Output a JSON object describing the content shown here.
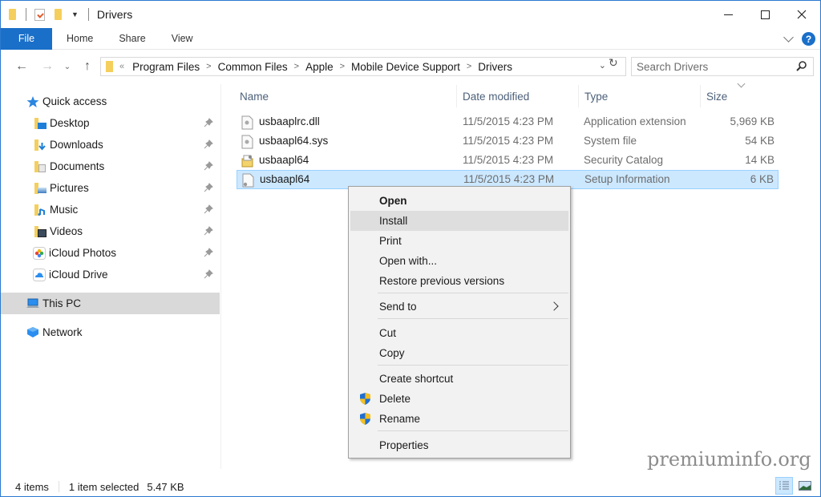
{
  "window": {
    "title": "Drivers",
    "controls": {
      "minimize": "minimize",
      "maximize": "maximize",
      "close": "close"
    }
  },
  "quick_access_toolbar": {
    "icons": [
      "folder-icon",
      "properties-icon",
      "new-folder-icon",
      "customize-dropdown-icon"
    ]
  },
  "ribbon": {
    "tabs": [
      {
        "label": "File",
        "active": true
      },
      {
        "label": "Home"
      },
      {
        "label": "Share"
      },
      {
        "label": "View"
      }
    ],
    "help_label": "?"
  },
  "navigation": {
    "back": "←",
    "forward": "→",
    "recent": "⌄",
    "up": "↑",
    "breadcrumb_overflow": "«",
    "breadcrumb": [
      "Program Files",
      "Common Files",
      "Apple",
      "Mobile Device Support",
      "Drivers"
    ],
    "refresh": "↻",
    "search": {
      "placeholder": "Search Drivers",
      "value": ""
    }
  },
  "sidebar": {
    "quick_access": {
      "label": "Quick access"
    },
    "items": [
      {
        "label": "Desktop",
        "pinned": true,
        "icon": "desktop-folder-icon"
      },
      {
        "label": "Downloads",
        "pinned": true,
        "icon": "downloads-folder-icon"
      },
      {
        "label": "Documents",
        "pinned": true,
        "icon": "documents-folder-icon"
      },
      {
        "label": "Pictures",
        "pinned": true,
        "icon": "pictures-folder-icon"
      },
      {
        "label": "Music",
        "pinned": true,
        "icon": "music-folder-icon"
      },
      {
        "label": "Videos",
        "pinned": true,
        "icon": "videos-folder-icon"
      },
      {
        "label": "iCloud Photos",
        "pinned": true,
        "icon": "icloud-photos-icon"
      },
      {
        "label": "iCloud Drive",
        "pinned": true,
        "icon": "icloud-drive-icon"
      }
    ],
    "this_pc": {
      "label": "This PC",
      "selected": true
    },
    "network": {
      "label": "Network"
    }
  },
  "file_list": {
    "columns": [
      "Name",
      "Date modified",
      "Type",
      "Size"
    ],
    "sorted_by": "Size",
    "rows": [
      {
        "name": "usbaaplrc.dll",
        "date": "11/5/2015 4:23 PM",
        "type": "Application extension",
        "size": "5,969 KB",
        "icon": "dll-file-icon",
        "selected": false
      },
      {
        "name": "usbaapl64.sys",
        "date": "11/5/2015 4:23 PM",
        "type": "System file",
        "size": "54 KB",
        "icon": "sys-file-icon",
        "selected": false
      },
      {
        "name": "usbaapl64",
        "date": "11/5/2015 4:23 PM",
        "type": "Security Catalog",
        "size": "14 KB",
        "icon": "security-catalog-icon",
        "selected": false
      },
      {
        "name": "usbaapl64",
        "date": "11/5/2015 4:23 PM",
        "type": "Setup Information",
        "size": "6 KB",
        "icon": "setup-info-icon",
        "selected": true
      }
    ]
  },
  "context_menu": {
    "items": [
      {
        "label": "Open",
        "bold": true
      },
      {
        "label": "Install",
        "hover": true
      },
      {
        "label": "Print"
      },
      {
        "label": "Open with..."
      },
      {
        "label": "Restore previous versions"
      },
      {
        "label": "Send to",
        "submenu": true
      },
      {
        "label": "Cut"
      },
      {
        "label": "Copy"
      },
      {
        "label": "Create shortcut"
      },
      {
        "label": "Delete",
        "shield": true
      },
      {
        "label": "Rename",
        "shield": true
      },
      {
        "label": "Properties"
      }
    ]
  },
  "status_bar": {
    "item_count": "4 items",
    "selection": "1 item selected",
    "selection_size": "5.47 KB",
    "views": [
      "details-view",
      "large-icons-view"
    ],
    "active_view": "details-view"
  },
  "watermark": "premiuminfo.org",
  "colors": {
    "accent": "#1a6fc9",
    "selection_bg": "#cce8ff",
    "selection_border": "#99d1ff",
    "context_menu_bg": "#f2f2f2",
    "context_hover": "#dedede",
    "folder_yellow": "#f5cf5d"
  }
}
